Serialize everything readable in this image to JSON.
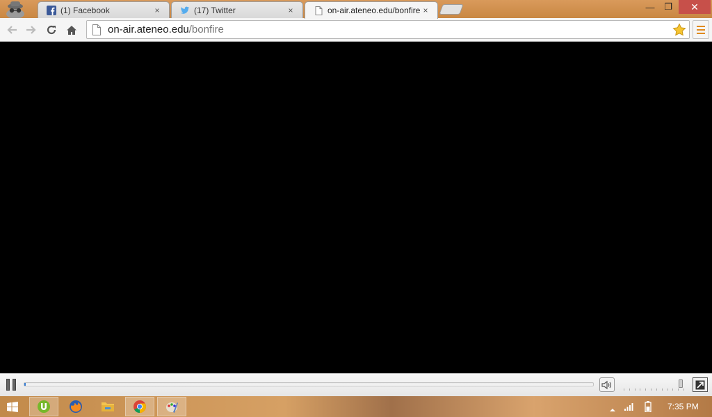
{
  "browser": {
    "tabs": [
      {
        "title": "(1) Facebook",
        "icon": "facebook-icon",
        "active": false
      },
      {
        "title": "(17) Twitter",
        "icon": "twitter-icon",
        "active": false
      },
      {
        "title": "on-air.ateneo.edu/bonfire",
        "icon": "page-icon",
        "active": true
      }
    ],
    "close_glyph": "×",
    "window_controls": {
      "minimize": "—",
      "restore": "❐",
      "close": "✕"
    }
  },
  "toolbar": {
    "url_host": "on-air.ateneo.edu",
    "url_path": "/bonfire",
    "bookmark_icon": "star-icon",
    "menu_icon": "hamburger-menu-icon"
  },
  "player": {
    "state": "playing",
    "seek_progress": 0.002,
    "volume_level": 0.95,
    "muted": false
  },
  "taskbar": {
    "apps": [
      {
        "name": "utorrent",
        "icon": "utorrent-icon",
        "active": true
      },
      {
        "name": "firefox",
        "icon": "firefox-icon",
        "active": false
      },
      {
        "name": "file-explorer",
        "icon": "folder-icon",
        "active": false
      },
      {
        "name": "chrome",
        "icon": "chrome-icon",
        "active": true
      },
      {
        "name": "paint",
        "icon": "paint-icon",
        "active": true
      }
    ],
    "clock": "7:35 PM"
  },
  "colors": {
    "title_bar": "#d08f4f",
    "window_close": "#c7504a",
    "seek_fill": "#3a7fd5",
    "video_bg": "#000000"
  }
}
